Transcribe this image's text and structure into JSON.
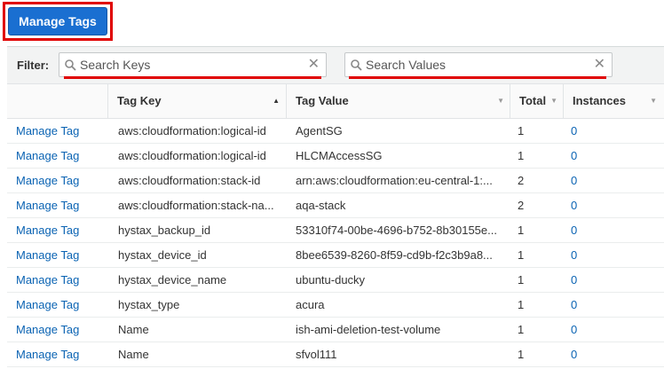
{
  "toolbar": {
    "manage_tags_label": "Manage Tags"
  },
  "filter": {
    "label": "Filter:",
    "keys_placeholder": "Search Keys",
    "values_placeholder": "Search Values",
    "clear_glyph": "✕"
  },
  "columns": {
    "tag_key": "Tag Key",
    "tag_value": "Tag Value",
    "total": "Total",
    "instances": "Instances",
    "sort_asc_glyph": "▲",
    "sort_glyph": "▼"
  },
  "rows": [
    {
      "action": "Manage Tag",
      "key": "aws:cloudformation:logical-id",
      "value": "AgentSG",
      "total": "1",
      "instances": "0"
    },
    {
      "action": "Manage Tag",
      "key": "aws:cloudformation:logical-id",
      "value": "HLCMAccessSG",
      "total": "1",
      "instances": "0"
    },
    {
      "action": "Manage Tag",
      "key": "aws:cloudformation:stack-id",
      "value": "arn:aws:cloudformation:eu-central-1:...",
      "total": "2",
      "instances": "0"
    },
    {
      "action": "Manage Tag",
      "key": "aws:cloudformation:stack-na...",
      "value": "aqa-stack",
      "total": "2",
      "instances": "0"
    },
    {
      "action": "Manage Tag",
      "key": "hystax_backup_id",
      "value": "53310f74-00be-4696-b752-8b30155e...",
      "total": "1",
      "instances": "0"
    },
    {
      "action": "Manage Tag",
      "key": "hystax_device_id",
      "value": "8bee6539-8260-8f59-cd9b-f2c3b9a8...",
      "total": "1",
      "instances": "0"
    },
    {
      "action": "Manage Tag",
      "key": "hystax_device_name",
      "value": "ubuntu-ducky",
      "total": "1",
      "instances": "0"
    },
    {
      "action": "Manage Tag",
      "key": "hystax_type",
      "value": "acura",
      "total": "1",
      "instances": "0"
    },
    {
      "action": "Manage Tag",
      "key": "Name",
      "value": "ish-ami-deletion-test-volume",
      "total": "1",
      "instances": "0"
    },
    {
      "action": "Manage Tag",
      "key": "Name",
      "value": "sfvol111",
      "total": "1",
      "instances": "0"
    }
  ],
  "colors": {
    "accent": "#1a6fd1",
    "link": "#0a63b3",
    "highlight": "#e00000"
  },
  "icons": {
    "search": "magnifier-icon",
    "clear": "clear-icon",
    "sort": "sort-caret-icon"
  }
}
